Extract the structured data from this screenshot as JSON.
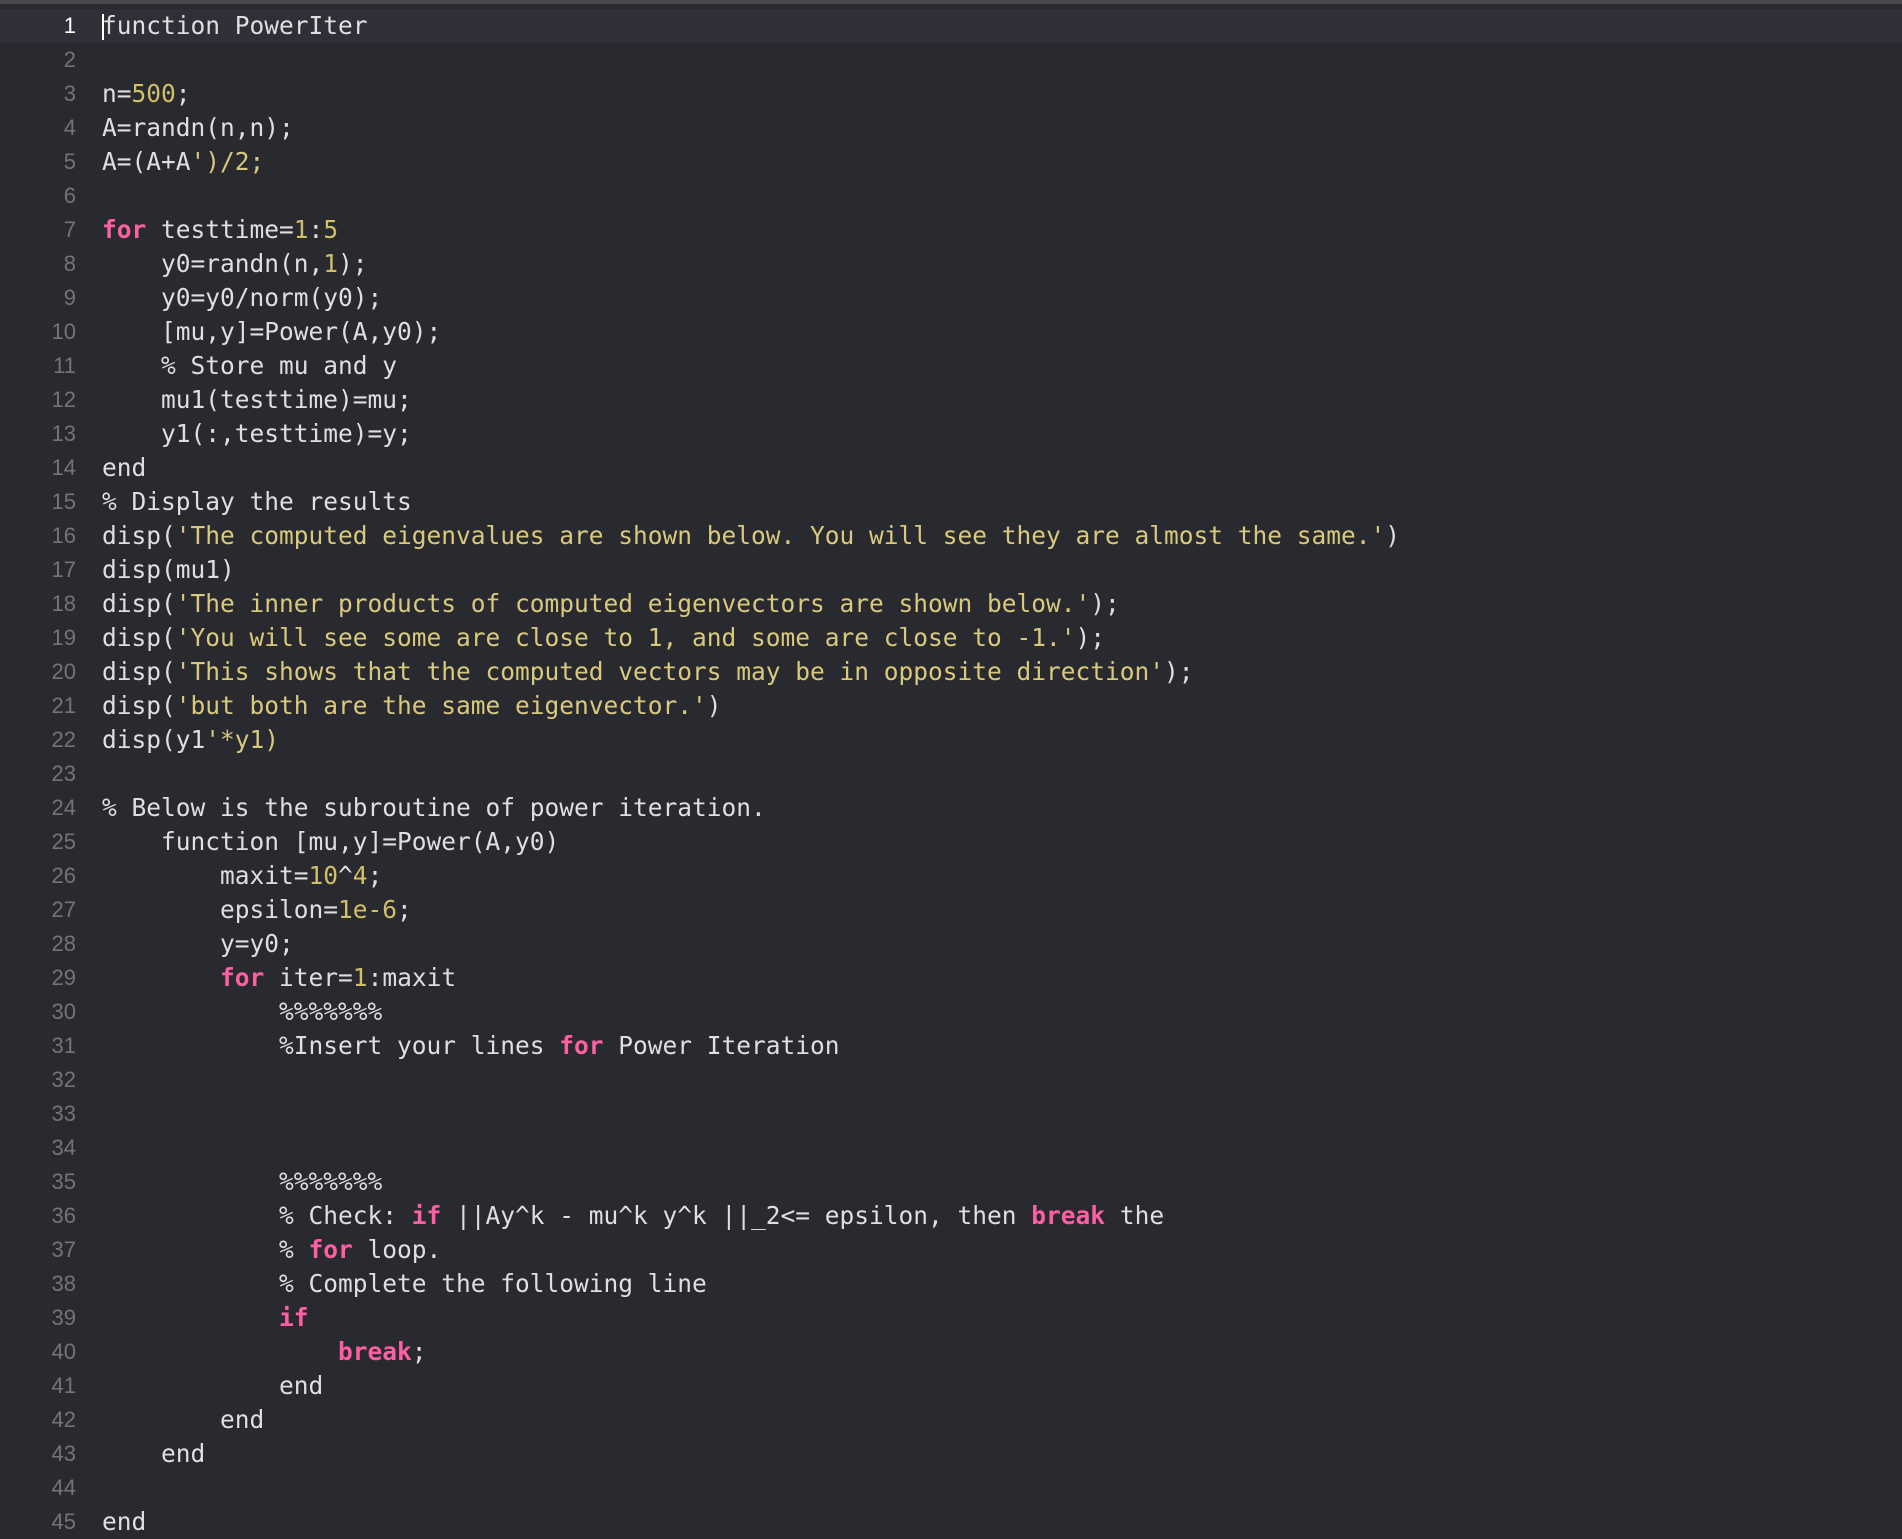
{
  "editor": {
    "language": "MATLAB",
    "cursor_line": 1,
    "lines": [
      {
        "num": "1",
        "tokens": [
          {
            "t": "function PowerIter",
            "c": "plain"
          }
        ]
      },
      {
        "num": "2",
        "tokens": []
      },
      {
        "num": "3",
        "tokens": [
          {
            "t": "n=",
            "c": "plain"
          },
          {
            "t": "500",
            "c": "num"
          },
          {
            "t": ";",
            "c": "plain"
          }
        ]
      },
      {
        "num": "4",
        "tokens": [
          {
            "t": "A=randn(n,n);",
            "c": "plain"
          }
        ]
      },
      {
        "num": "5",
        "tokens": [
          {
            "t": "A=(A+A",
            "c": "plain"
          },
          {
            "t": "')/2;",
            "c": "yel"
          }
        ]
      },
      {
        "num": "6",
        "tokens": []
      },
      {
        "num": "7",
        "tokens": [
          {
            "t": "for",
            "c": "kw"
          },
          {
            "t": " testtime=",
            "c": "plain"
          },
          {
            "t": "1",
            "c": "num"
          },
          {
            "t": ":",
            "c": "plain"
          },
          {
            "t": "5",
            "c": "num"
          }
        ]
      },
      {
        "num": "8",
        "tokens": [
          {
            "t": "    y0=randn(n,",
            "c": "plain"
          },
          {
            "t": "1",
            "c": "num"
          },
          {
            "t": ");",
            "c": "plain"
          }
        ]
      },
      {
        "num": "9",
        "tokens": [
          {
            "t": "    y0=y0/norm(y0);",
            "c": "plain"
          }
        ]
      },
      {
        "num": "10",
        "tokens": [
          {
            "t": "    [mu,y]=Power(A,y0);",
            "c": "plain"
          }
        ]
      },
      {
        "num": "11",
        "tokens": [
          {
            "t": "    % Store mu and y",
            "c": "plain"
          }
        ]
      },
      {
        "num": "12",
        "tokens": [
          {
            "t": "    mu1(testtime)=mu;",
            "c": "plain"
          }
        ]
      },
      {
        "num": "13",
        "tokens": [
          {
            "t": "    y1(:,testtime)=y;",
            "c": "plain"
          }
        ]
      },
      {
        "num": "14",
        "tokens": [
          {
            "t": "end",
            "c": "plain"
          }
        ]
      },
      {
        "num": "15",
        "tokens": [
          {
            "t": "% Display the results",
            "c": "plain"
          }
        ]
      },
      {
        "num": "16",
        "tokens": [
          {
            "t": "disp(",
            "c": "plain"
          },
          {
            "t": "'The computed eigenvalues are shown below. You will see they are almost the same.'",
            "c": "yel"
          },
          {
            "t": ")",
            "c": "plain"
          }
        ]
      },
      {
        "num": "17",
        "tokens": [
          {
            "t": "disp(mu1)",
            "c": "plain"
          }
        ]
      },
      {
        "num": "18",
        "tokens": [
          {
            "t": "disp(",
            "c": "plain"
          },
          {
            "t": "'The inner products of computed eigenvectors are shown below.'",
            "c": "yel"
          },
          {
            "t": ");",
            "c": "plain"
          }
        ]
      },
      {
        "num": "19",
        "tokens": [
          {
            "t": "disp(",
            "c": "plain"
          },
          {
            "t": "'You will see some are close to 1, and some are close to -1.'",
            "c": "yel"
          },
          {
            "t": ");",
            "c": "plain"
          }
        ]
      },
      {
        "num": "20",
        "tokens": [
          {
            "t": "disp(",
            "c": "plain"
          },
          {
            "t": "'This shows that the computed vectors may be in opposite direction'",
            "c": "yel"
          },
          {
            "t": ");",
            "c": "plain"
          }
        ]
      },
      {
        "num": "21",
        "tokens": [
          {
            "t": "disp(",
            "c": "plain"
          },
          {
            "t": "'but both are the same eigenvector.'",
            "c": "yel"
          },
          {
            "t": ")",
            "c": "plain"
          }
        ]
      },
      {
        "num": "22",
        "tokens": [
          {
            "t": "disp(y1",
            "c": "plain"
          },
          {
            "t": "'*y1)",
            "c": "yel"
          }
        ]
      },
      {
        "num": "23",
        "tokens": []
      },
      {
        "num": "24",
        "tokens": [
          {
            "t": "% Below is the subroutine of power iteration.",
            "c": "plain"
          }
        ]
      },
      {
        "num": "25",
        "tokens": [
          {
            "t": "    function [mu,y]=Power(A,y0)",
            "c": "plain"
          }
        ]
      },
      {
        "num": "26",
        "tokens": [
          {
            "t": "        maxit=",
            "c": "plain"
          },
          {
            "t": "10",
            "c": "num"
          },
          {
            "t": "^",
            "c": "plain"
          },
          {
            "t": "4",
            "c": "num"
          },
          {
            "t": ";",
            "c": "plain"
          }
        ]
      },
      {
        "num": "27",
        "tokens": [
          {
            "t": "        epsilon=",
            "c": "plain"
          },
          {
            "t": "1e-6",
            "c": "num"
          },
          {
            "t": ";",
            "c": "plain"
          }
        ]
      },
      {
        "num": "28",
        "tokens": [
          {
            "t": "        y=y0;",
            "c": "plain"
          }
        ]
      },
      {
        "num": "29",
        "tokens": [
          {
            "t": "        ",
            "c": "plain"
          },
          {
            "t": "for",
            "c": "kw"
          },
          {
            "t": " iter=",
            "c": "plain"
          },
          {
            "t": "1",
            "c": "num"
          },
          {
            "t": ":maxit",
            "c": "plain"
          }
        ]
      },
      {
        "num": "30",
        "tokens": [
          {
            "t": "            %%%%%%%",
            "c": "plain"
          }
        ]
      },
      {
        "num": "31",
        "tokens": [
          {
            "t": "            %Insert your lines ",
            "c": "plain"
          },
          {
            "t": "for",
            "c": "kw"
          },
          {
            "t": " Power Iteration",
            "c": "plain"
          }
        ]
      },
      {
        "num": "32",
        "tokens": []
      },
      {
        "num": "33",
        "tokens": []
      },
      {
        "num": "34",
        "tokens": []
      },
      {
        "num": "35",
        "tokens": [
          {
            "t": "            %%%%%%%",
            "c": "plain"
          }
        ]
      },
      {
        "num": "36",
        "tokens": [
          {
            "t": "            % Check: ",
            "c": "plain"
          },
          {
            "t": "if",
            "c": "kw"
          },
          {
            "t": " ||Ay^k - mu^k y^k ||_2<= epsilon, then ",
            "c": "plain"
          },
          {
            "t": "break",
            "c": "kw"
          },
          {
            "t": " the",
            "c": "plain"
          }
        ]
      },
      {
        "num": "37",
        "tokens": [
          {
            "t": "            % ",
            "c": "plain"
          },
          {
            "t": "for",
            "c": "kw"
          },
          {
            "t": " loop.",
            "c": "plain"
          }
        ]
      },
      {
        "num": "38",
        "tokens": [
          {
            "t": "            % Complete the following line",
            "c": "plain"
          }
        ]
      },
      {
        "num": "39",
        "tokens": [
          {
            "t": "            ",
            "c": "plain"
          },
          {
            "t": "if",
            "c": "kw"
          }
        ]
      },
      {
        "num": "40",
        "tokens": [
          {
            "t": "                ",
            "c": "plain"
          },
          {
            "t": "break",
            "c": "kw"
          },
          {
            "t": ";",
            "c": "plain"
          }
        ]
      },
      {
        "num": "41",
        "tokens": [
          {
            "t": "            end",
            "c": "plain"
          }
        ]
      },
      {
        "num": "42",
        "tokens": [
          {
            "t": "        end",
            "c": "plain"
          }
        ]
      },
      {
        "num": "43",
        "tokens": [
          {
            "t": "    end",
            "c": "plain"
          }
        ]
      },
      {
        "num": "44",
        "tokens": []
      },
      {
        "num": "45",
        "tokens": [
          {
            "t": "end",
            "c": "plain"
          }
        ]
      }
    ]
  }
}
